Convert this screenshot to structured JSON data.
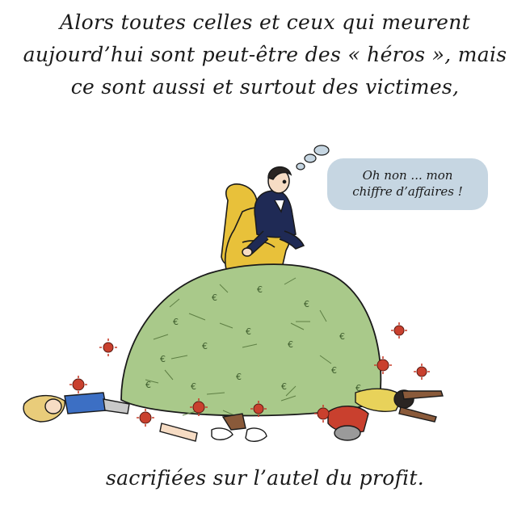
{
  "caption_top": {
    "line1": "Alors toutes celles et ceux qui meurent",
    "line2": "aujourd’hui sont peut-être des « héros », mais",
    "line3": "ce sont aussi et surtout des victimes,"
  },
  "speech_bubble": {
    "line1": "Oh non ... mon",
    "line2": "chiffre d’affaires !"
  },
  "caption_bottom": {
    "text": "sacrifiées sur l’autel du profit."
  },
  "colors": {
    "money_green": "#a9c98a",
    "armchair_yellow": "#e8c13a",
    "virus_red": "#c9402e",
    "bubble_blue": "#c6d6e2",
    "suit_navy": "#1f2a55"
  },
  "icons": [
    "euro-banknote-icon",
    "coronavirus-icon"
  ]
}
